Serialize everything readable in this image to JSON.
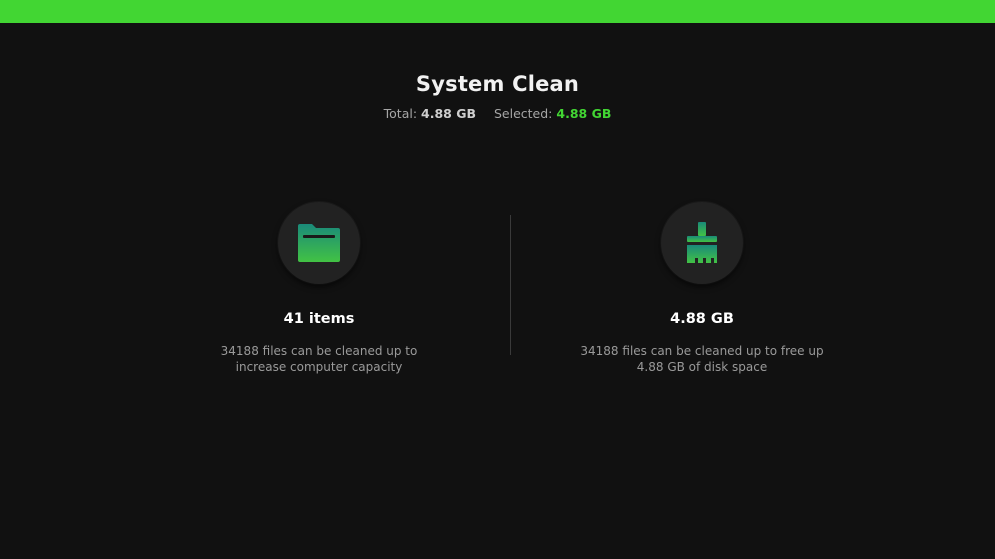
{
  "colors": {
    "accent": "#42d633",
    "background": "#111111",
    "icon_gradient_top": "#1a8a7a",
    "icon_gradient_bottom": "#42c244"
  },
  "header": {
    "title": "System Clean",
    "total_label": "Total:",
    "total_value": "4.88 GB",
    "selected_label": "Selected:",
    "selected_value": "4.88 GB"
  },
  "cards": [
    {
      "icon": "folder-icon",
      "value": "41 items",
      "description": "34188 files can be cleaned up to increase computer capacity"
    },
    {
      "icon": "broom-icon",
      "value": "4.88 GB",
      "description": "34188 files can be cleaned up to free up 4.88 GB of disk space"
    }
  ]
}
